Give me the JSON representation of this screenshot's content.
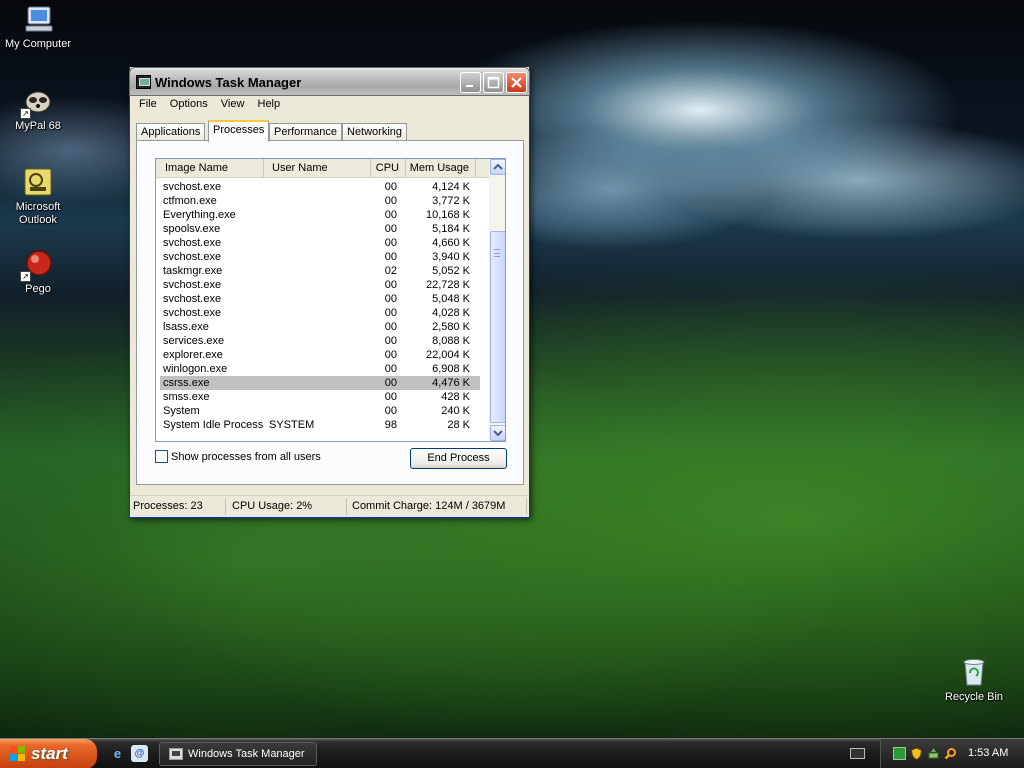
{
  "desktop": {
    "icons": [
      {
        "label": "My Computer",
        "icon": "my-computer-icon"
      },
      {
        "label": "MyPal 68",
        "icon": "mypal-browser-icon"
      },
      {
        "label": "Microsoft Outlook",
        "icon": "outlook-icon"
      },
      {
        "label": "Pego",
        "icon": "pego-icon"
      },
      {
        "label": "Recycle Bin",
        "icon": "recycle-bin-icon"
      }
    ]
  },
  "window": {
    "title": "Windows Task Manager",
    "menu": [
      "File",
      "Options",
      "View",
      "Help"
    ],
    "tabs": [
      "Applications",
      "Processes",
      "Performance",
      "Networking"
    ],
    "active_tab": "Processes",
    "columns": {
      "name": "Image Name",
      "user": "User Name",
      "cpu": "CPU",
      "mem": "Mem Usage"
    },
    "processes": [
      {
        "name": "svchost.exe",
        "user": "",
        "cpu": "00",
        "mem": "4,124 K"
      },
      {
        "name": "ctfmon.exe",
        "user": "",
        "cpu": "00",
        "mem": "3,772 K"
      },
      {
        "name": "Everything.exe",
        "user": "",
        "cpu": "00",
        "mem": "10,168 K"
      },
      {
        "name": "spoolsv.exe",
        "user": "",
        "cpu": "00",
        "mem": "5,184 K"
      },
      {
        "name": "svchost.exe",
        "user": "",
        "cpu": "00",
        "mem": "4,660 K"
      },
      {
        "name": "svchost.exe",
        "user": "",
        "cpu": "00",
        "mem": "3,940 K"
      },
      {
        "name": "taskmgr.exe",
        "user": "",
        "cpu": "02",
        "mem": "5,052 K"
      },
      {
        "name": "svchost.exe",
        "user": "",
        "cpu": "00",
        "mem": "22,728 K"
      },
      {
        "name": "svchost.exe",
        "user": "",
        "cpu": "00",
        "mem": "5,048 K"
      },
      {
        "name": "svchost.exe",
        "user": "",
        "cpu": "00",
        "mem": "4,028 K"
      },
      {
        "name": "lsass.exe",
        "user": "",
        "cpu": "00",
        "mem": "2,580 K"
      },
      {
        "name": "services.exe",
        "user": "",
        "cpu": "00",
        "mem": "8,088 K"
      },
      {
        "name": "explorer.exe",
        "user": "",
        "cpu": "00",
        "mem": "22,004 K"
      },
      {
        "name": "winlogon.exe",
        "user": "",
        "cpu": "00",
        "mem": "6,908 K"
      },
      {
        "name": "csrss.exe",
        "user": "",
        "cpu": "00",
        "mem": "4,476 K",
        "selected": true
      },
      {
        "name": "smss.exe",
        "user": "",
        "cpu": "00",
        "mem": "428 K"
      },
      {
        "name": "System",
        "user": "",
        "cpu": "00",
        "mem": "240 K"
      },
      {
        "name": "System Idle Process",
        "user": "SYSTEM",
        "cpu": "98",
        "mem": "28 K"
      }
    ],
    "show_all_label": "Show processes from all users",
    "show_all_checked": false,
    "end_process_label": "End Process",
    "status": {
      "processes": "Processes: 23",
      "cpu": "CPU Usage: 2%",
      "commit": "Commit Charge: 124M / 3679M"
    }
  },
  "taskbar": {
    "start_label": "start",
    "quick_launch": [
      "internet-explorer-icon",
      "outlook-express-icon"
    ],
    "task_button": "Windows Task Manager",
    "clock": "1:53 AM",
    "tray_icons": [
      "network-icon",
      "security-shield-icon",
      "safely-remove-icon",
      "search-icon"
    ]
  },
  "colors": {
    "window_frame": "#0831d9",
    "selection": "#c0c0c0",
    "start_button": "#d9531b",
    "panel_bg": "#ece9d8"
  }
}
